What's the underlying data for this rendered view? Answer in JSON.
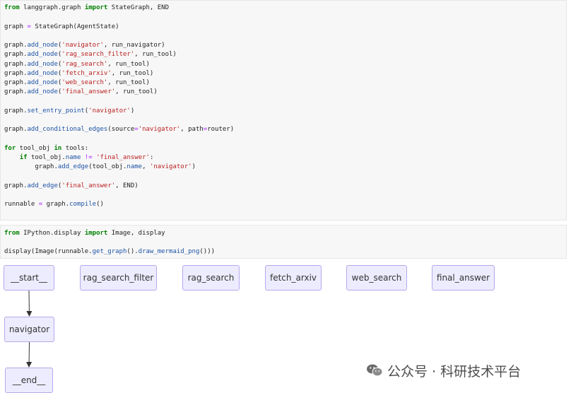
{
  "cells": [
    {
      "lines": [
        [
          {
            "t": "from",
            "c": "kw"
          },
          {
            "t": " langgraph.graph ",
            "c": "plain"
          },
          {
            "t": "import",
            "c": "kw"
          },
          {
            "t": " StateGraph, END",
            "c": "plain"
          }
        ],
        [],
        [
          {
            "t": "graph ",
            "c": "plain"
          },
          {
            "t": "=",
            "c": "op"
          },
          {
            "t": " StateGraph(AgentState)",
            "c": "plain"
          }
        ],
        [],
        [
          {
            "t": "graph.",
            "c": "plain"
          },
          {
            "t": "add_node",
            "c": "call"
          },
          {
            "t": "(",
            "c": "plain"
          },
          {
            "t": "'navigator'",
            "c": "str"
          },
          {
            "t": ", run_navigator)",
            "c": "plain"
          }
        ],
        [
          {
            "t": "graph.",
            "c": "plain"
          },
          {
            "t": "add_node",
            "c": "call"
          },
          {
            "t": "(",
            "c": "plain"
          },
          {
            "t": "'rag_search_filter'",
            "c": "str"
          },
          {
            "t": ", run_tool)",
            "c": "plain"
          }
        ],
        [
          {
            "t": "graph.",
            "c": "plain"
          },
          {
            "t": "add_node",
            "c": "call"
          },
          {
            "t": "(",
            "c": "plain"
          },
          {
            "t": "'rag_search'",
            "c": "str"
          },
          {
            "t": ", run_tool)",
            "c": "plain"
          }
        ],
        [
          {
            "t": "graph.",
            "c": "plain"
          },
          {
            "t": "add_node",
            "c": "call"
          },
          {
            "t": "(",
            "c": "plain"
          },
          {
            "t": "'fetch_arxiv'",
            "c": "str"
          },
          {
            "t": ", run_tool)",
            "c": "plain"
          }
        ],
        [
          {
            "t": "graph.",
            "c": "plain"
          },
          {
            "t": "add_node",
            "c": "call"
          },
          {
            "t": "(",
            "c": "plain"
          },
          {
            "t": "'web_search'",
            "c": "str"
          },
          {
            "t": ", run_tool)",
            "c": "plain"
          }
        ],
        [
          {
            "t": "graph.",
            "c": "plain"
          },
          {
            "t": "add_node",
            "c": "call"
          },
          {
            "t": "(",
            "c": "plain"
          },
          {
            "t": "'final_answer'",
            "c": "str"
          },
          {
            "t": ", run_tool)",
            "c": "plain"
          }
        ],
        [],
        [
          {
            "t": "graph.",
            "c": "plain"
          },
          {
            "t": "set_entry_point",
            "c": "call"
          },
          {
            "t": "(",
            "c": "plain"
          },
          {
            "t": "'navigator'",
            "c": "str"
          },
          {
            "t": ")",
            "c": "plain"
          }
        ],
        [],
        [
          {
            "t": "graph.",
            "c": "plain"
          },
          {
            "t": "add_conditional_edges",
            "c": "call"
          },
          {
            "t": "(source",
            "c": "plain"
          },
          {
            "t": "=",
            "c": "op"
          },
          {
            "t": "'navigator'",
            "c": "str"
          },
          {
            "t": ", path",
            "c": "plain"
          },
          {
            "t": "=",
            "c": "op"
          },
          {
            "t": "router)",
            "c": "plain"
          }
        ],
        [],
        [
          {
            "t": "for",
            "c": "kw"
          },
          {
            "t": " tool_obj ",
            "c": "plain"
          },
          {
            "t": "in",
            "c": "kw"
          },
          {
            "t": " tools:",
            "c": "plain"
          }
        ],
        [
          {
            "t": "    ",
            "c": "plain"
          },
          {
            "t": "if",
            "c": "kw"
          },
          {
            "t": " tool_obj.",
            "c": "plain"
          },
          {
            "t": "name",
            "c": "call"
          },
          {
            "t": " ",
            "c": "plain"
          },
          {
            "t": "!=",
            "c": "op"
          },
          {
            "t": " ",
            "c": "plain"
          },
          {
            "t": "'final_answer'",
            "c": "str"
          },
          {
            "t": ":",
            "c": "plain"
          }
        ],
        [
          {
            "t": "        graph.",
            "c": "plain"
          },
          {
            "t": "add_edge",
            "c": "call"
          },
          {
            "t": "(tool_obj.",
            "c": "plain"
          },
          {
            "t": "name",
            "c": "call"
          },
          {
            "t": ", ",
            "c": "plain"
          },
          {
            "t": "'navigator'",
            "c": "str"
          },
          {
            "t": ")",
            "c": "plain"
          }
        ],
        [],
        [
          {
            "t": "graph.",
            "c": "plain"
          },
          {
            "t": "add_edge",
            "c": "call"
          },
          {
            "t": "(",
            "c": "plain"
          },
          {
            "t": "'final_answer'",
            "c": "str"
          },
          {
            "t": ", END)",
            "c": "plain"
          }
        ],
        [],
        [
          {
            "t": "runnable ",
            "c": "plain"
          },
          {
            "t": "=",
            "c": "op"
          },
          {
            "t": " graph.",
            "c": "plain"
          },
          {
            "t": "compile",
            "c": "call"
          },
          {
            "t": "()",
            "c": "plain"
          }
        ]
      ]
    },
    {
      "lines": [
        [
          {
            "t": "from",
            "c": "kw"
          },
          {
            "t": " IPython.display ",
            "c": "plain"
          },
          {
            "t": "import",
            "c": "kw"
          },
          {
            "t": " Image, display",
            "c": "plain"
          }
        ],
        [],
        [
          {
            "t": "display(Image(runnable.",
            "c": "plain"
          },
          {
            "t": "get_graph",
            "c": "call"
          },
          {
            "t": "().",
            "c": "plain"
          },
          {
            "t": "draw_mermaid_png",
            "c": "call"
          },
          {
            "t": "()))",
            "c": "plain"
          }
        ]
      ]
    }
  ],
  "graph": {
    "nodes": {
      "start": "__start__",
      "rag_search_filter": "rag_search_filter",
      "rag_search": "rag_search",
      "fetch_arxiv": "fetch_arxiv",
      "web_search": "web_search",
      "final_answer": "final_answer",
      "navigator": "navigator",
      "end": "__end__"
    },
    "edges": [
      [
        "start",
        "navigator"
      ],
      [
        "navigator",
        "end"
      ]
    ]
  },
  "watermark": {
    "text": "公众号 · 科研技术平台",
    "icon": "wechat-icon"
  }
}
